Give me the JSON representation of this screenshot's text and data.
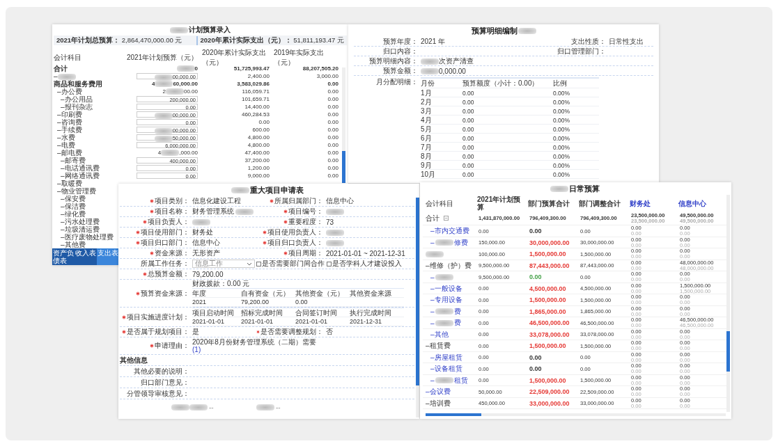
{
  "plan_entry_window": {
    "title": [
      {
        "redacted": true
      },
      "计划预算录入"
    ],
    "summary": [
      "**2021年计划总预算：** 2,864,470,000.00 元",
      "**2020年累计实际支出（元）：** 51,811,193.47 元"
    ],
    "columns": [
      "会计科目",
      "2021年计划预算（元）",
      "2020年累计实际支出（元）",
      "2019年实际支出（元）"
    ],
    "rows": [
      {
        "label": "合计",
        "bold": true,
        "values": [
          [
            {
              "redacted": true
            },
            "0"
          ],
          "51,725,993.47",
          "88,207,505.20"
        ]
      },
      {
        "label": [
          "–",
          {
            "redacted": true
          }
        ],
        "input": true,
        "values": [
          [
            {
              "redacted": true
            },
            "00,000.00"
          ],
          "2,400.00",
          "3,000.00"
        ]
      },
      {
        "label": "商品和服务费用",
        "bold": true,
        "values": [
          [
            "4",
            {
              "redacted": true
            },
            "60,000.00"
          ],
          "3,583,029.86",
          "0.00"
        ],
        "children": [
          {
            "label": "–办公费",
            "values": [
              [
                "2",
                {
                  "redacted": true
                },
                "00.00"
              ],
              "116,059.71",
              "0.00"
            ],
            "children": [
              {
                "label": "–办公用品",
                "input": true,
                "values": [
                  "200,000.00",
                  "101,659.71",
                  "0.00"
                ]
              },
              {
                "label": "–报刊杂志",
                "input": true,
                "values": [
                  "0.00",
                  "14,400.00",
                  "0.00"
                ]
              }
            ]
          },
          {
            "label": "–印刷费",
            "input": true,
            "values": [
              [
                {
                  "redacted": true
                },
                "00,000.00"
              ],
              "460,284.53",
              "0.00"
            ]
          },
          {
            "label": "–咨询费",
            "input": true,
            "values": [
              "0.00",
              "0.00",
              "0.00"
            ]
          },
          {
            "label": "–手续费",
            "input": true,
            "values": [
              [
                {
                  "redacted": true
                },
                "00,000.00"
              ],
              "600.00",
              "0.00"
            ]
          },
          {
            "label": "–水费",
            "input": true,
            "values": [
              [
                {
                  "redacted": true
                },
                "50,000.00"
              ],
              "4,800.00",
              "0.00"
            ]
          },
          {
            "label": "–电费",
            "input": true,
            "values": [
              "6,000,000.00",
              "4,800.00",
              "0.00"
            ]
          },
          {
            "label": "–邮电费",
            "values": [
              [
                "4",
                {
                  "redacted": true
                },
                ",000.00"
              ],
              "47,400.00",
              "0.00"
            ],
            "children": [
              {
                "label": "–邮寄费",
                "input": true,
                "values": [
                  "400,000.00",
                  "37,200.00",
                  "0.00"
                ]
              },
              {
                "label": "–电话通讯费",
                "input": true,
                "values": [
                  "0.00",
                  "1,200.00",
                  "0.00"
                ]
              },
              {
                "label": "–网络通讯费",
                "input": true,
                "values": [
                  "0.00",
                  "9,000.00",
                  "0.00"
                ]
              }
            ]
          },
          {
            "label": "–取暖费"
          },
          {
            "label": "–物业管理费",
            "children": [
              {
                "label": "–保安费"
              },
              {
                "label": "–保洁费"
              },
              {
                "label": "–绿化费"
              },
              {
                "label": "–污水处理费"
              },
              {
                "label": "–垃圾清运费"
              },
              {
                "label": "–医疗废物处理费"
              },
              {
                "label": "–其他费"
              }
            ]
          }
        ]
      }
    ],
    "tabs": [
      {
        "label": "资产负债表",
        "selected": false
      },
      {
        "label": "收入表",
        "selected": false
      },
      {
        "label": "支出表",
        "selected": true
      }
    ]
  },
  "budget_detail_window": {
    "title": [
      "预算明细编制",
      {
        "redacted": true
      }
    ],
    "fields": [
      [
        {
          "label": "预算年度：",
          "value": "2021 年"
        },
        {
          "label": "支出性质：",
          "value": "日常性支出"
        }
      ],
      [
        {
          "label": "归口内容："
        },
        {
          "label": "归口管理部门："
        }
      ],
      [
        {
          "label": "预算明细内容：",
          "value": [
            {
              "redacted": true
            },
            "次资产清查"
          ]
        }
      ],
      [
        {
          "label": "预算金额：",
          "value": [
            {
              "redacted": true
            },
            "0,000.00"
          ]
        }
      ]
    ],
    "month_label": "月分配明细：",
    "month_columns": [
      "月份",
      "预算额度（小计：0.00）",
      "比例"
    ],
    "months": [
      {
        "month": "1月",
        "amount": "0.00",
        "ratio": "0.00%"
      },
      {
        "month": "2月",
        "amount": "0.00",
        "ratio": "0.00%"
      },
      {
        "month": "3月",
        "amount": "0.00",
        "ratio": "0.00%"
      },
      {
        "month": "4月",
        "amount": "0.00",
        "ratio": "0.00%"
      },
      {
        "month": "5月",
        "amount": "0.00",
        "ratio": "0.00%"
      },
      {
        "month": "6月",
        "amount": "0.00",
        "ratio": "0.00%"
      },
      {
        "month": "7月",
        "amount": "0.00",
        "ratio": "0.00%"
      },
      {
        "month": "8月",
        "amount": "0.00",
        "ratio": "0.00%"
      },
      {
        "month": "9月",
        "amount": "0.00",
        "ratio": "0.00%"
      },
      {
        "month": "10月",
        "amount": "0.00",
        "ratio": "0.00%"
      }
    ]
  },
  "project_application_window": {
    "title": [
      {
        "redacted": true
      },
      "重大项目申请表"
    ],
    "sections": [
      {
        "kind": "pair",
        "items": [
          {
            "label": "项目类别：",
            "required": true,
            "value": "信息化建设工程"
          },
          {
            "label": "所属归属部门：",
            "required": true,
            "value": "信息中心"
          }
        ]
      },
      {
        "kind": "pair",
        "items": [
          {
            "label": "项目名称：",
            "required": true,
            "value": [
              "财务管理系统",
              {
                "redacted": true
              }
            ]
          },
          {
            "label": "项目编号：",
            "required": true,
            "value": [
              {
                "redacted": true
              }
            ]
          }
        ]
      },
      {
        "kind": "pair",
        "items": [
          {
            "label": "项目负责人：",
            "required": true,
            "value": [
              {
                "redacted": true
              }
            ]
          },
          {
            "label": "重要程度：",
            "required": true,
            "value": "73"
          }
        ]
      },
      {
        "kind": "pair",
        "items": [
          {
            "label": "项目使用部门：",
            "required": true,
            "value": "财务处"
          },
          {
            "label": "项目使用负责人：",
            "required": true,
            "value": [
              {
                "redacted": true
              }
            ]
          }
        ]
      },
      {
        "kind": "pair",
        "items": [
          {
            "label": "项目归口部门：",
            "required": true,
            "value": "信息中心"
          },
          {
            "label": "项目归口负责人：",
            "required": true,
            "value": [
              {
                "redacted": true
              }
            ]
          }
        ]
      },
      {
        "kind": "pair",
        "items": [
          {
            "label": "资金来源：",
            "required": true,
            "value": "无形资产"
          },
          {
            "label": "项目周期：",
            "required": true,
            "value": "2021-01-01 ~ 2021-12-31"
          }
        ]
      },
      {
        "kind": "task",
        "label": "所属工作任务：",
        "select": "信息工作",
        "checks": [
          {
            "label": "是否需要部门间合作",
            "checked": false
          },
          {
            "label": "是否学科人才建设投入",
            "checked": false
          }
        ]
      },
      {
        "kind": "single",
        "label": "总预算金额：",
        "required": true,
        "value": "79,200.00"
      },
      {
        "kind": "table",
        "label": "预算资金来源：",
        "required": true,
        "note": "财政拨款：0.00 元",
        "columns": [
          "年度",
          "自有资金（元）",
          "其他资金（元）",
          "其他资金来源"
        ],
        "rows": [
          [
            "2021",
            "79,200.00",
            "0.00"
          ]
        ]
      },
      {
        "kind": "table",
        "label": "项目实施进度计划：",
        "required": true,
        "columns": [
          "项目启动时间",
          "招标完成时间",
          "合同签订时间",
          "执行完成时间"
        ],
        "rows": [
          [
            "2021-01-01",
            "2021-01-01",
            "2021-01-01",
            "2021-12-31"
          ]
        ]
      },
      {
        "kind": "pair",
        "items": [
          {
            "label": "是否属于规划项目：",
            "required": true,
            "value": "是"
          },
          {
            "label": "是否需要调整规划：",
            "required": true,
            "value": "否"
          }
        ]
      },
      {
        "kind": "reason",
        "label": "申请理由：",
        "required": true,
        "value": "2020年8月份财务管理系统（二期）需要",
        "link": "(1)"
      },
      {
        "kind": "heading",
        "text": "其他信息"
      },
      {
        "kind": "opinion",
        "label": "其他必要的说明："
      },
      {
        "kind": "opinion",
        "label": "归口部门意见："
      },
      {
        "kind": "opinion",
        "label": "分管领导审核意见："
      },
      {
        "kind": "footer",
        "cells": [
          [
            {
              "redacted": true
            }
          ],
          [
            {
              "redacted": true
            },
            "--"
          ],
          [
            {
              "redacted": true
            },
            "--"
          ]
        ]
      }
    ]
  },
  "daily_budget_window": {
    "title": [
      {
        "redacted": true
      },
      "日常预算"
    ],
    "columns": [
      {
        "label": "会计科目",
        "link": false
      },
      {
        "label": "2021年计划预算",
        "link": false
      },
      {
        "label": "部门预算合计",
        "link": false
      },
      {
        "label": "部门调整合计",
        "link": false
      },
      {
        "label": "财务处",
        "link": true
      },
      {
        "label": "信息中心",
        "link": true
      }
    ],
    "total": {
      "label": "合计",
      "plan": "1,431,870,000.00",
      "dept": "796,409,300.00",
      "adj": "796,409,300.00",
      "finance": [
        "23,500,000.00",
        "23,500,000.00"
      ],
      "info": [
        "49,500,000.00",
        "49,500,000.00"
      ]
    },
    "rows": [
      {
        "children": [
          {
            "label": "–市内交通费",
            "link": true,
            "plan": "0.00",
            "dept": "0.00",
            "color": "#333333",
            "adj": "0.00",
            "finance": [
              "0.00",
              "0.00"
            ],
            "info": [
              "0.00",
              "0.00"
            ]
          },
          {
            "label": [
              "–",
              {
                "redacted": true
              },
              "修费"
            ],
            "link": true,
            "plan": "150,000.00",
            "dept": "30,000,000.00",
            "color": "#e53935",
            "adj": "30,000,000.00",
            "finance": [
              "0.00",
              "0.00"
            ],
            "info": [
              "0.00",
              "0.00"
            ]
          }
        ]
      },
      {
        "label": [
          {
            "redacted": true
          }
        ],
        "link": true,
        "plan": "100,000.00",
        "dept": "1,500,000.00",
        "color": "#e53935",
        "adj": "1,500,000.00",
        "finance": [
          "0.00",
          "0.00"
        ],
        "info": [
          "0.00",
          "0.00"
        ]
      },
      {
        "label": "–维修（护）费",
        "link": false,
        "plan": "9,500,000.00",
        "dept": "87,443,000.00",
        "color": "#e53935",
        "adj": "87,443,000.00",
        "finance": [
          "0.00",
          "0.00"
        ],
        "info": [
          "48,000,000.00",
          "48,000,000.00"
        ],
        "children": [
          {
            "label": [
              "–",
              {
                "redacted": true
              }
            ],
            "link": true,
            "plan": "9,500,000.00",
            "dept": "0.00",
            "color": "#43a047",
            "adj": "0.00",
            "finance": [
              "0.00",
              "0.00"
            ],
            "info": [
              "0.00",
              "0.00"
            ]
          },
          {
            "label": "–一般设备",
            "link": true,
            "plan": "0.00",
            "dept": "4,500,000.00",
            "color": "#e53935",
            "adj": "4,500,000.00",
            "finance": [
              "0.00",
              "0.00"
            ],
            "info": [
              "1,500,000.00",
              "1,500,000.00"
            ]
          },
          {
            "label": "–专用设备",
            "link": true,
            "plan": "0.00",
            "dept": "1,500,000.00",
            "color": "#e53935",
            "adj": "1,500,000.00",
            "finance": [
              "0.00",
              "0.00"
            ],
            "info": [
              "0.00",
              "0.00"
            ]
          },
          {
            "label": [
              "–",
              {
                "redacted": true
              },
              "费"
            ],
            "link": true,
            "plan": "0.00",
            "dept": "1,865,000.00",
            "color": "#e53935",
            "adj": "1,865,000.00",
            "finance": [
              "0.00",
              "0.00"
            ],
            "info": [
              "0.00",
              "0.00"
            ]
          },
          {
            "label": [
              "–",
              {
                "redacted": true
              },
              "费"
            ],
            "link": true,
            "plan": "0.00",
            "dept": "46,500,000.00",
            "color": "#e53935",
            "adj": "46,500,000.00",
            "finance": [
              "0.00",
              "0.00"
            ],
            "info": [
              "46,500,000.00",
              "46,500,000.00"
            ]
          },
          {
            "label": "–其他",
            "link": true,
            "plan": "0.00",
            "dept": "33,078,000.00",
            "color": "#e53935",
            "adj": "33,078,000.00",
            "finance": [
              "0.00",
              "0.00"
            ],
            "info": [
              "0.00",
              "0.00"
            ]
          }
        ]
      },
      {
        "label": "–租赁费",
        "link": false,
        "plan": "0.00",
        "dept": "1,500,000.00",
        "color": "#e53935",
        "adj": "1,500,000.00",
        "finance": [
          "0.00",
          "0.00"
        ],
        "info": [
          "0.00",
          "0.00"
        ],
        "children": [
          {
            "label": "–房屋租赁",
            "link": true,
            "plan": "0.00",
            "dept": "0.00",
            "color": "#333333",
            "adj": "0.00",
            "finance": [
              "0.00",
              "0.00"
            ],
            "info": [
              "0.00",
              "0.00"
            ]
          },
          {
            "label": "–设备租赁",
            "link": true,
            "plan": "0.00",
            "dept": "0.00",
            "color": "#333333",
            "adj": "0.00",
            "finance": [
              "0.00",
              "0.00"
            ],
            "info": [
              "0.00",
              "0.00"
            ]
          },
          {
            "label": [
              "–",
              {
                "redacted": true
              },
              "租赁"
            ],
            "link": true,
            "plan": "0.00",
            "dept": "1,500,000.00",
            "color": "#e53935",
            "adj": "1,500,000.00",
            "finance": [
              "0.00",
              "0.00"
            ],
            "info": [
              "0.00",
              "0.00"
            ]
          }
        ]
      },
      {
        "label": "–会议费",
        "link": true,
        "plan": "50,000.00",
        "dept": "22,509,000.00",
        "color": "#e53935",
        "adj": "22,509,000.00",
        "finance": [
          "0.00",
          "0.00"
        ],
        "info": [
          "0.00",
          "0.00"
        ]
      },
      {
        "label": "–培训费",
        "link": false,
        "plan": "450,000.00",
        "dept": "33,000,000.00",
        "color": "#e53935",
        "adj": "33,000,000.00",
        "finance": [
          "0.00",
          "0.00"
        ],
        "info": [
          "0.00",
          "0.00"
        ]
      }
    ]
  }
}
